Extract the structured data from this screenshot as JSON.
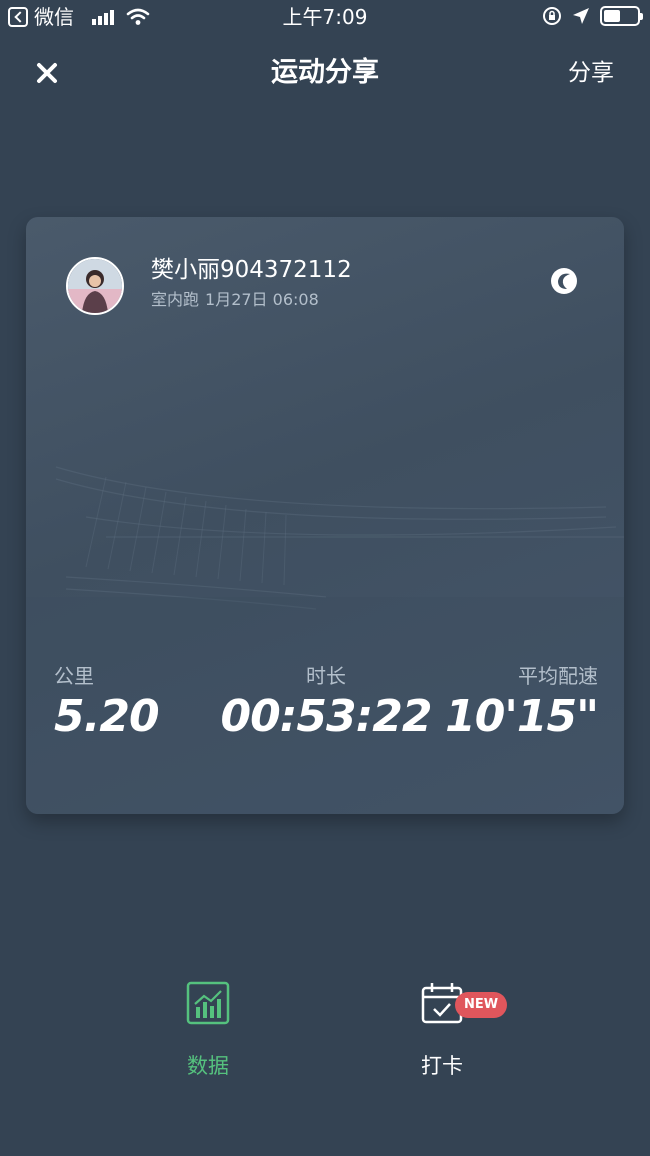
{
  "status_bar": {
    "back_app": "微信",
    "time": "上午7:09",
    "battery_level": 0.5
  },
  "nav": {
    "title": "运动分享",
    "share_label": "分享"
  },
  "card": {
    "user_name": "樊小丽904372112",
    "activity_type": "室内跑",
    "date_time": "1月27日 06:08",
    "stats": [
      {
        "label": "公里",
        "value": "5.20"
      },
      {
        "label": "时长",
        "value": "00:53:22"
      },
      {
        "label": "平均配速",
        "value": "10'15\""
      }
    ]
  },
  "tabs": [
    {
      "label": "数据",
      "icon": "bar-chart-icon",
      "active": true
    },
    {
      "label": "打卡",
      "icon": "calendar-check-icon",
      "badge": "NEW"
    }
  ],
  "colors": {
    "background": "#344353",
    "accent_green": "#55c17e",
    "badge_red": "#e0565c"
  }
}
